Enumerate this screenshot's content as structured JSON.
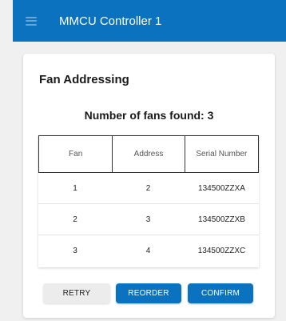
{
  "appbar": {
    "title": "MMCU Controller 1",
    "menu_icon": "hamburger-menu-icon",
    "color": "#0b72bf"
  },
  "card": {
    "title": "Fan Addressing",
    "fans_found": "Number of fans found: 3"
  },
  "table": {
    "headers": [
      "Fan",
      "Address",
      "Serial Number"
    ],
    "rows": [
      [
        "1",
        "2",
        "134500ZZXA"
      ],
      [
        "2",
        "3",
        "134500ZZXB"
      ],
      [
        "3",
        "4",
        "134500ZZXC"
      ]
    ]
  },
  "actions": {
    "retry": "RETRY",
    "reorder": "REORDER",
    "confirm": "CONFIRM"
  }
}
